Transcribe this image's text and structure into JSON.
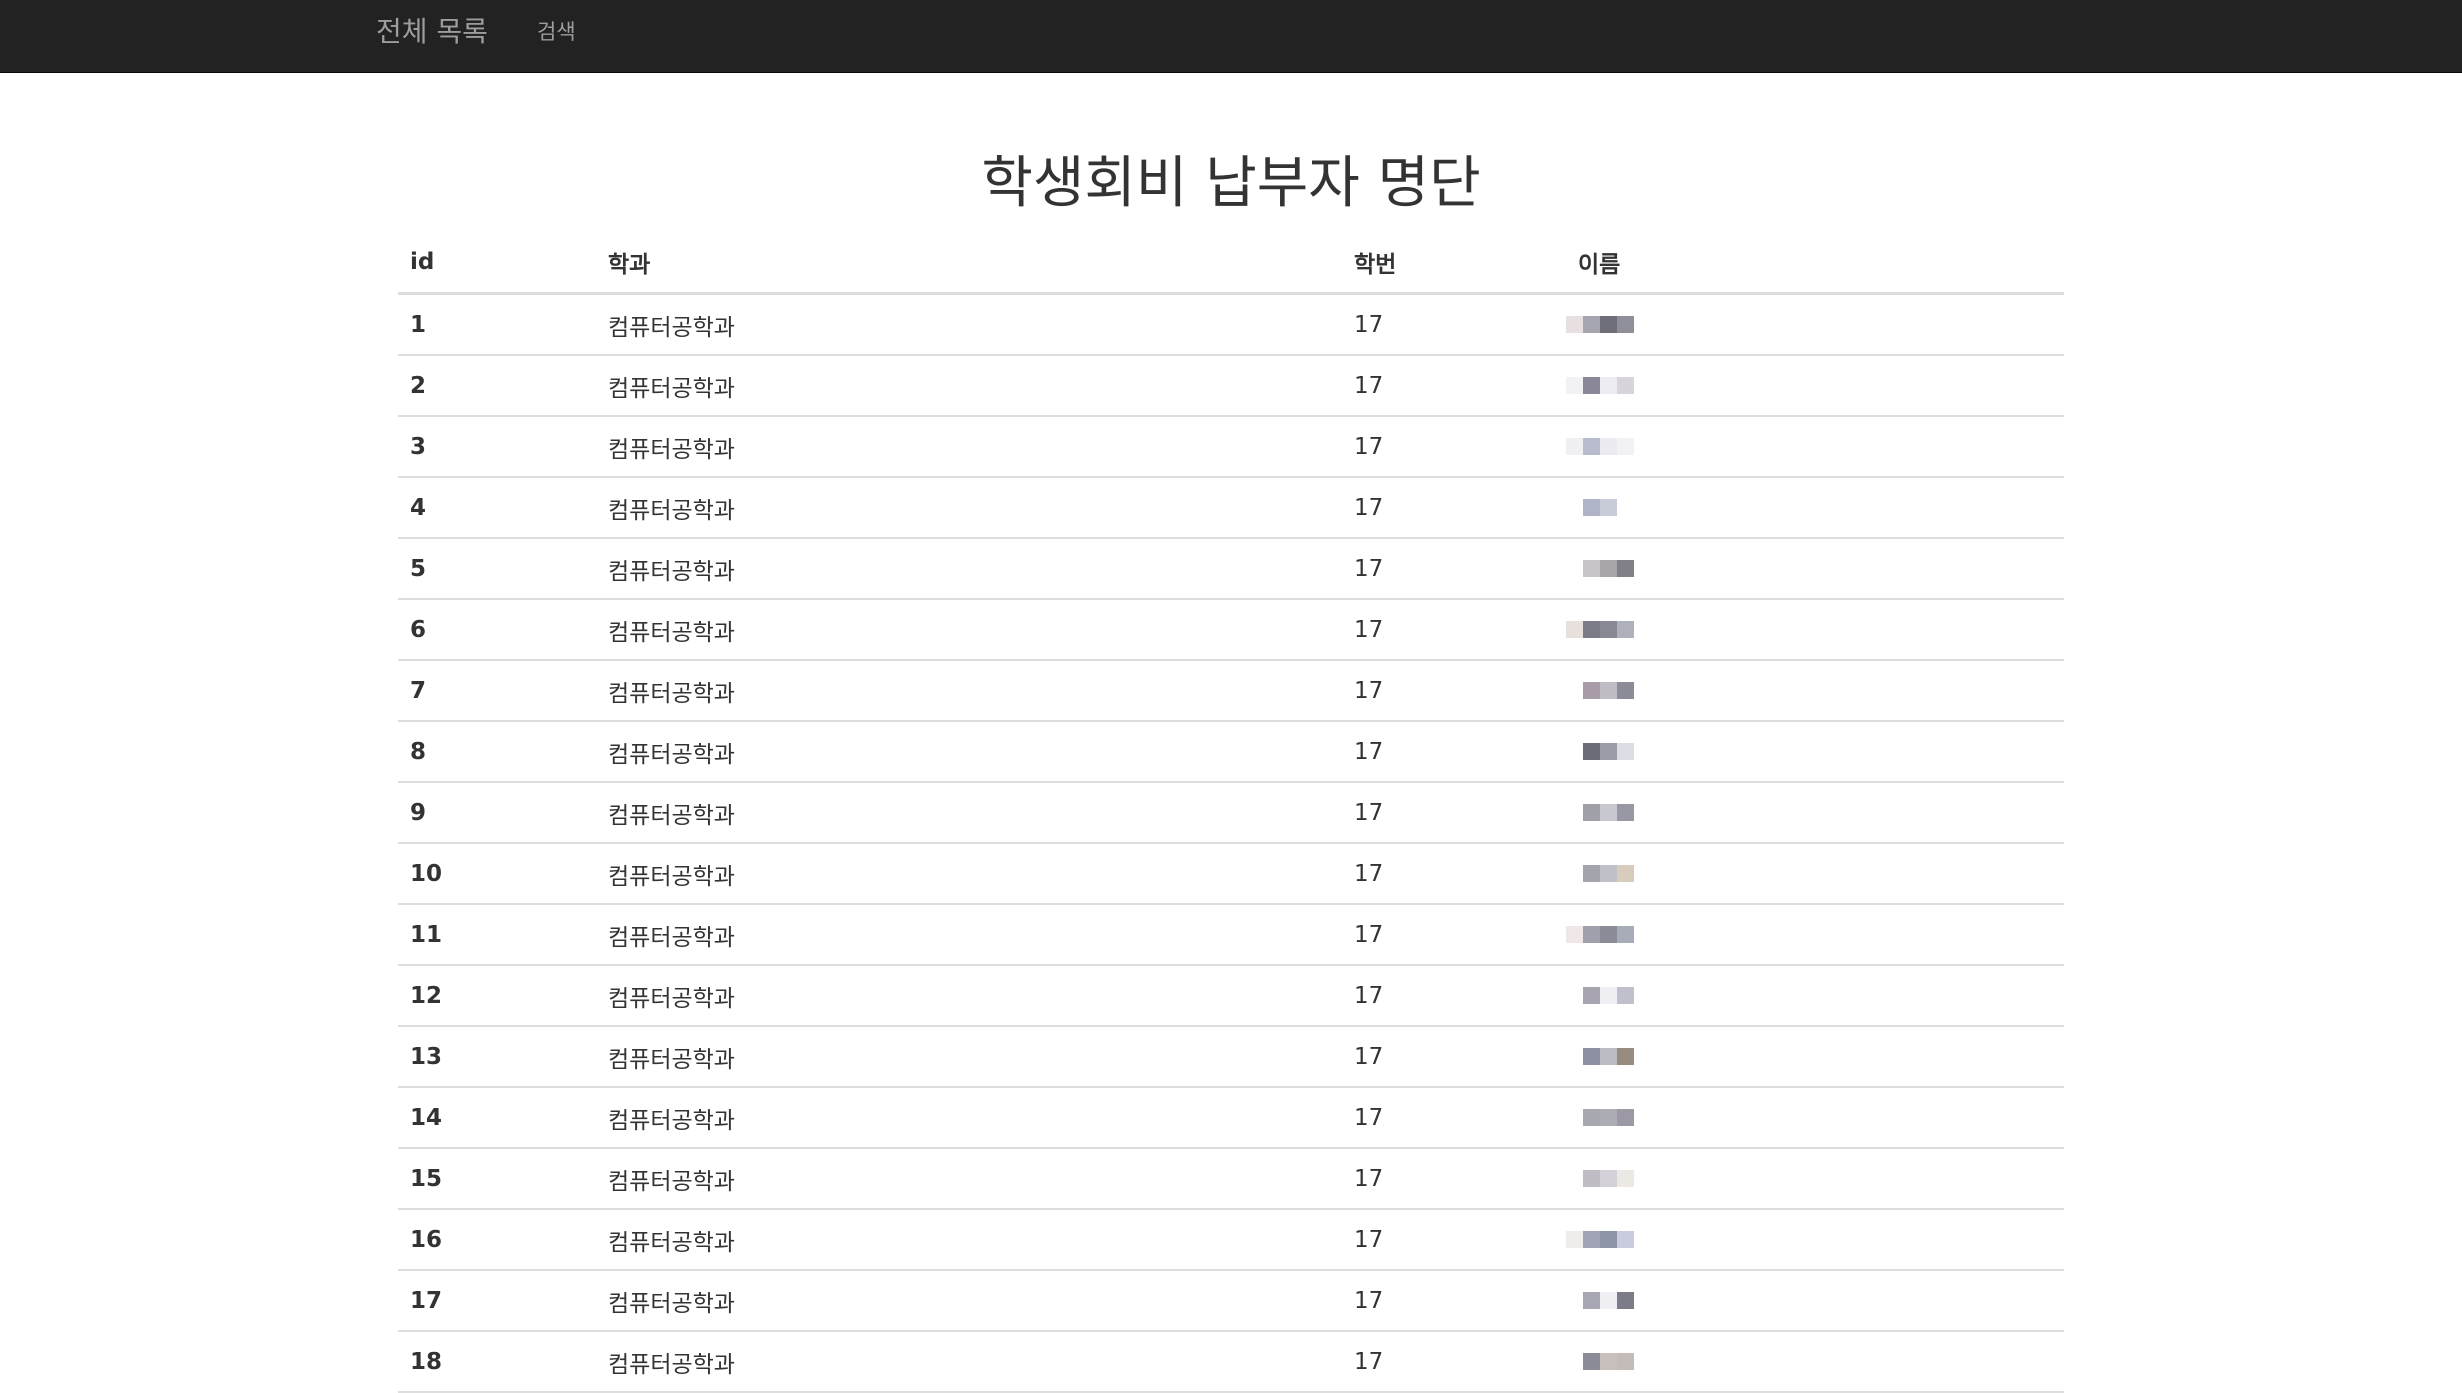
{
  "navbar": {
    "brand": "전체 목록",
    "search_link": "검색"
  },
  "page": {
    "title": "학생회비 납부자 명단"
  },
  "table": {
    "headers": {
      "id": "id",
      "department": "학과",
      "year": "학번",
      "name": "이름"
    },
    "rows": [
      {
        "id": "1",
        "department": "컴퓨터공학과",
        "year": "17",
        "name_pixels": [
          "#e8e0e0",
          "#a5a5b0",
          "#6e6e78",
          "#8f8f99"
        ]
      },
      {
        "id": "2",
        "department": "컴퓨터공학과",
        "year": "17",
        "name_pixels": [
          "#f2f2f5",
          "#8a8898",
          "#ececf2",
          "#d8d4dc"
        ]
      },
      {
        "id": "3",
        "department": "컴퓨터공학과",
        "year": "17",
        "name_pixels": [
          "#f0f0f4",
          "#b8bccc",
          "#eaeaf0",
          "#f2f2f5"
        ]
      },
      {
        "id": "4",
        "department": "컴퓨터공학과",
        "year": "17",
        "name_pixels": [
          "#ffffff",
          "#b0b4c8",
          "#c8ccd8",
          "#ffffff"
        ]
      },
      {
        "id": "5",
        "department": "컴퓨터공학과",
        "year": "17",
        "name_pixels": [
          "#ffffff",
          "#c8c4c8",
          "#a8a4a8",
          "#808088"
        ]
      },
      {
        "id": "6",
        "department": "컴퓨터공학과",
        "year": "17",
        "name_pixels": [
          "#e8e0dc",
          "#7c7c88",
          "#888894",
          "#aeb0bc"
        ]
      },
      {
        "id": "7",
        "department": "컴퓨터공학과",
        "year": "17",
        "name_pixels": [
          "#ffffff",
          "#a89ca8",
          "#c0bcc4",
          "#8c8c98"
        ]
      },
      {
        "id": "8",
        "department": "컴퓨터공학과",
        "year": "17",
        "name_pixels": [
          "#ffffff",
          "#6c6c78",
          "#9c9ca8",
          "#dcdce4"
        ]
      },
      {
        "id": "9",
        "department": "컴퓨터공학과",
        "year": "17",
        "name_pixels": [
          "#ffffff",
          "#a0a0a8",
          "#c8c8d0",
          "#9898a4"
        ]
      },
      {
        "id": "10",
        "department": "컴퓨터공학과",
        "year": "17",
        "name_pixels": [
          "#ffffff",
          "#a4a4ac",
          "#c0c0c8",
          "#d8ccbc"
        ]
      },
      {
        "id": "11",
        "department": "컴퓨터공학과",
        "year": "17",
        "name_pixels": [
          "#f0e8e8",
          "#a0a0ac",
          "#8c8c98",
          "#a8acb8"
        ]
      },
      {
        "id": "12",
        "department": "컴퓨터공학과",
        "year": "17",
        "name_pixels": [
          "#ffffff",
          "#a8a4b0",
          "#f0f0f4",
          "#c0c0cc"
        ]
      },
      {
        "id": "13",
        "department": "컴퓨터공학과",
        "year": "17",
        "name_pixels": [
          "#ffffff",
          "#8c90a0",
          "#bcbcc4",
          "#988c80"
        ]
      },
      {
        "id": "14",
        "department": "컴퓨터공학과",
        "year": "17",
        "name_pixels": [
          "#ffffff",
          "#a8a8b0",
          "#acacb4",
          "#9c98a4"
        ]
      },
      {
        "id": "15",
        "department": "컴퓨터공학과",
        "year": "17",
        "name_pixels": [
          "#ffffff",
          "#c0bcc4",
          "#d4d0d8",
          "#ece8e4"
        ]
      },
      {
        "id": "16",
        "department": "컴퓨터공학과",
        "year": "17",
        "name_pixels": [
          "#f0ecec",
          "#a0a4b4",
          "#8c94a8",
          "#c8ccdc"
        ]
      },
      {
        "id": "17",
        "department": "컴퓨터공학과",
        "year": "17",
        "name_pixels": [
          "#ffffff",
          "#a8a8b4",
          "#f0f0f4",
          "#7c7c88"
        ]
      },
      {
        "id": "18",
        "department": "컴퓨터공학과",
        "year": "17",
        "name_pixels": [
          "#ffffff",
          "#8c8c98",
          "#c8c0bc",
          "#c4bcb8"
        ]
      }
    ]
  }
}
